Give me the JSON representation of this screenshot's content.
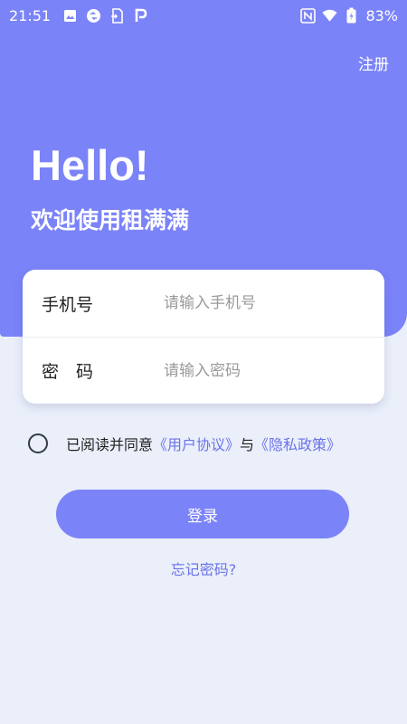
{
  "status_bar": {
    "time": "21:51",
    "battery": "83%",
    "icons": [
      "image-icon",
      "sync-icon",
      "sim-download-icon",
      "p-app-icon",
      "nfc-icon",
      "wifi-icon",
      "battery-charging-icon"
    ]
  },
  "header": {
    "register": "注册",
    "greeting": "Hello!",
    "welcome": "欢迎使用租满满"
  },
  "form": {
    "phone_label": "手机号",
    "phone_placeholder": "请输入手机号",
    "password_label": "密　码",
    "password_placeholder": "请输入密码"
  },
  "agreement": {
    "prefix": "已阅读并同意",
    "user_agreement": "《用户协议》",
    "connector": "与",
    "privacy_policy": "《隐私政策》",
    "checked": false
  },
  "actions": {
    "login": "登录",
    "forgot_password": "忘记密码?"
  },
  "colors": {
    "primary": "#7b83f8",
    "link": "#6b73e8",
    "background": "#eaeffa"
  }
}
